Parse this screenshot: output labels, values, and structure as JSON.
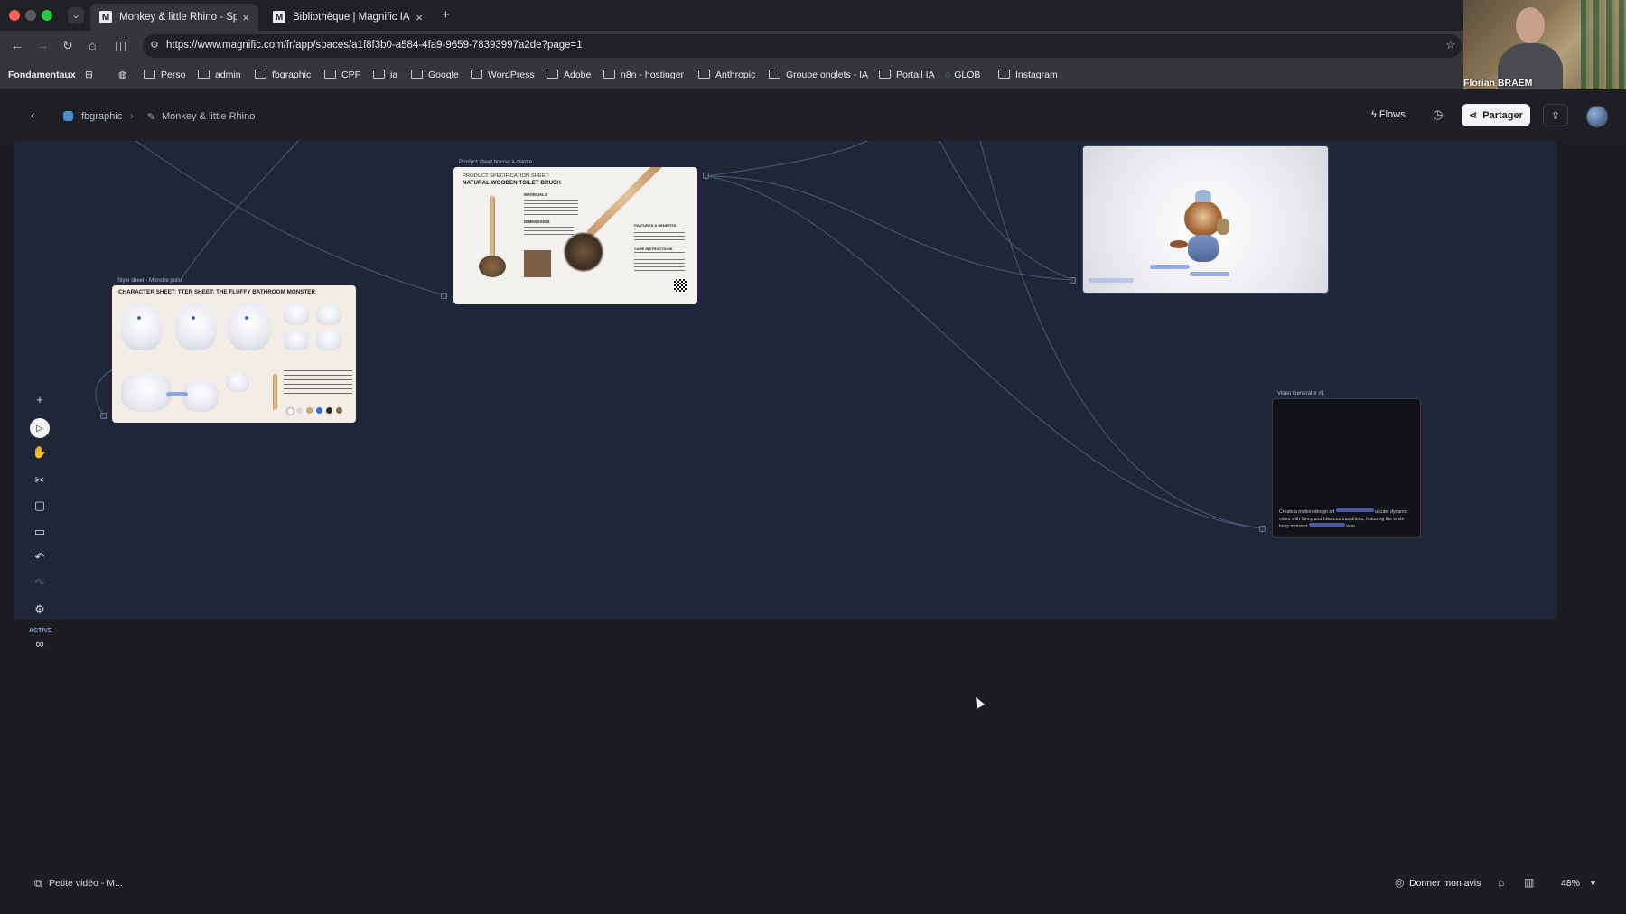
{
  "browser": {
    "tabs": [
      {
        "label": "Monkey & little Rhino - Space",
        "active": true
      },
      {
        "label": "Bibliothèque | Magnific IA",
        "active": false
      }
    ],
    "url": "https://www.magnific.com/fr/app/spaces/a1f8f3b0-a584-4fa9-9659-78393997a2de?page=1",
    "bookmarks": [
      "Fondamentaux",
      "Perso",
      "admin",
      "fbgraphic",
      "CPF",
      "ia",
      "Google",
      "WordPress",
      "Adobe",
      "n8n - hostinger",
      "Anthropic",
      "Groupe onglets - IA",
      "Portail IA",
      "GLOB",
      "Instagram"
    ]
  },
  "webcam": {
    "name": "Florian BRAEM"
  },
  "header": {
    "breadcrumb": [
      "fbgraphic",
      "Monkey & little Rhino"
    ],
    "flows_label": "Flows",
    "share_label": "Partager"
  },
  "nodes": {
    "charsheet": {
      "title": "Style sheet - Monstre poilu",
      "heading": "CHARACTER SHEET: TTER SHEET: THE FLUFFY BATHROOM MONSTER"
    },
    "brushsheet": {
      "title": "Product sheet brosse à chiotte",
      "heading_small": "PRODUCT SPECIFICATION SHEET:",
      "heading": "NATURAL WOODEN TOILET BRUSH",
      "sections": [
        "MATERIALS",
        "DIMENSIONS",
        "FEATURES & BENEFITS",
        "CARE INSTRUCTIONS"
      ]
    },
    "video": {
      "title": "Video Generator #1",
      "prompt_a": "Create a motion-design ad",
      "prompt_b": "a cute, dynamic video with funny and hilarious transitions, featuring the white hairy monster",
      "prompt_c": "who"
    }
  },
  "left_toolbar": {
    "active_label": "ACTIVE"
  },
  "bottom": {
    "page_label": "Petite vidéo - M...",
    "feedback_label": "Donner mon avis",
    "zoom": "48%"
  },
  "colors": {
    "canvas_bg": "#1f2638",
    "app_bg": "#1c1d21",
    "wire": "#5c6a96",
    "share_bg": "#f4f4f6"
  }
}
